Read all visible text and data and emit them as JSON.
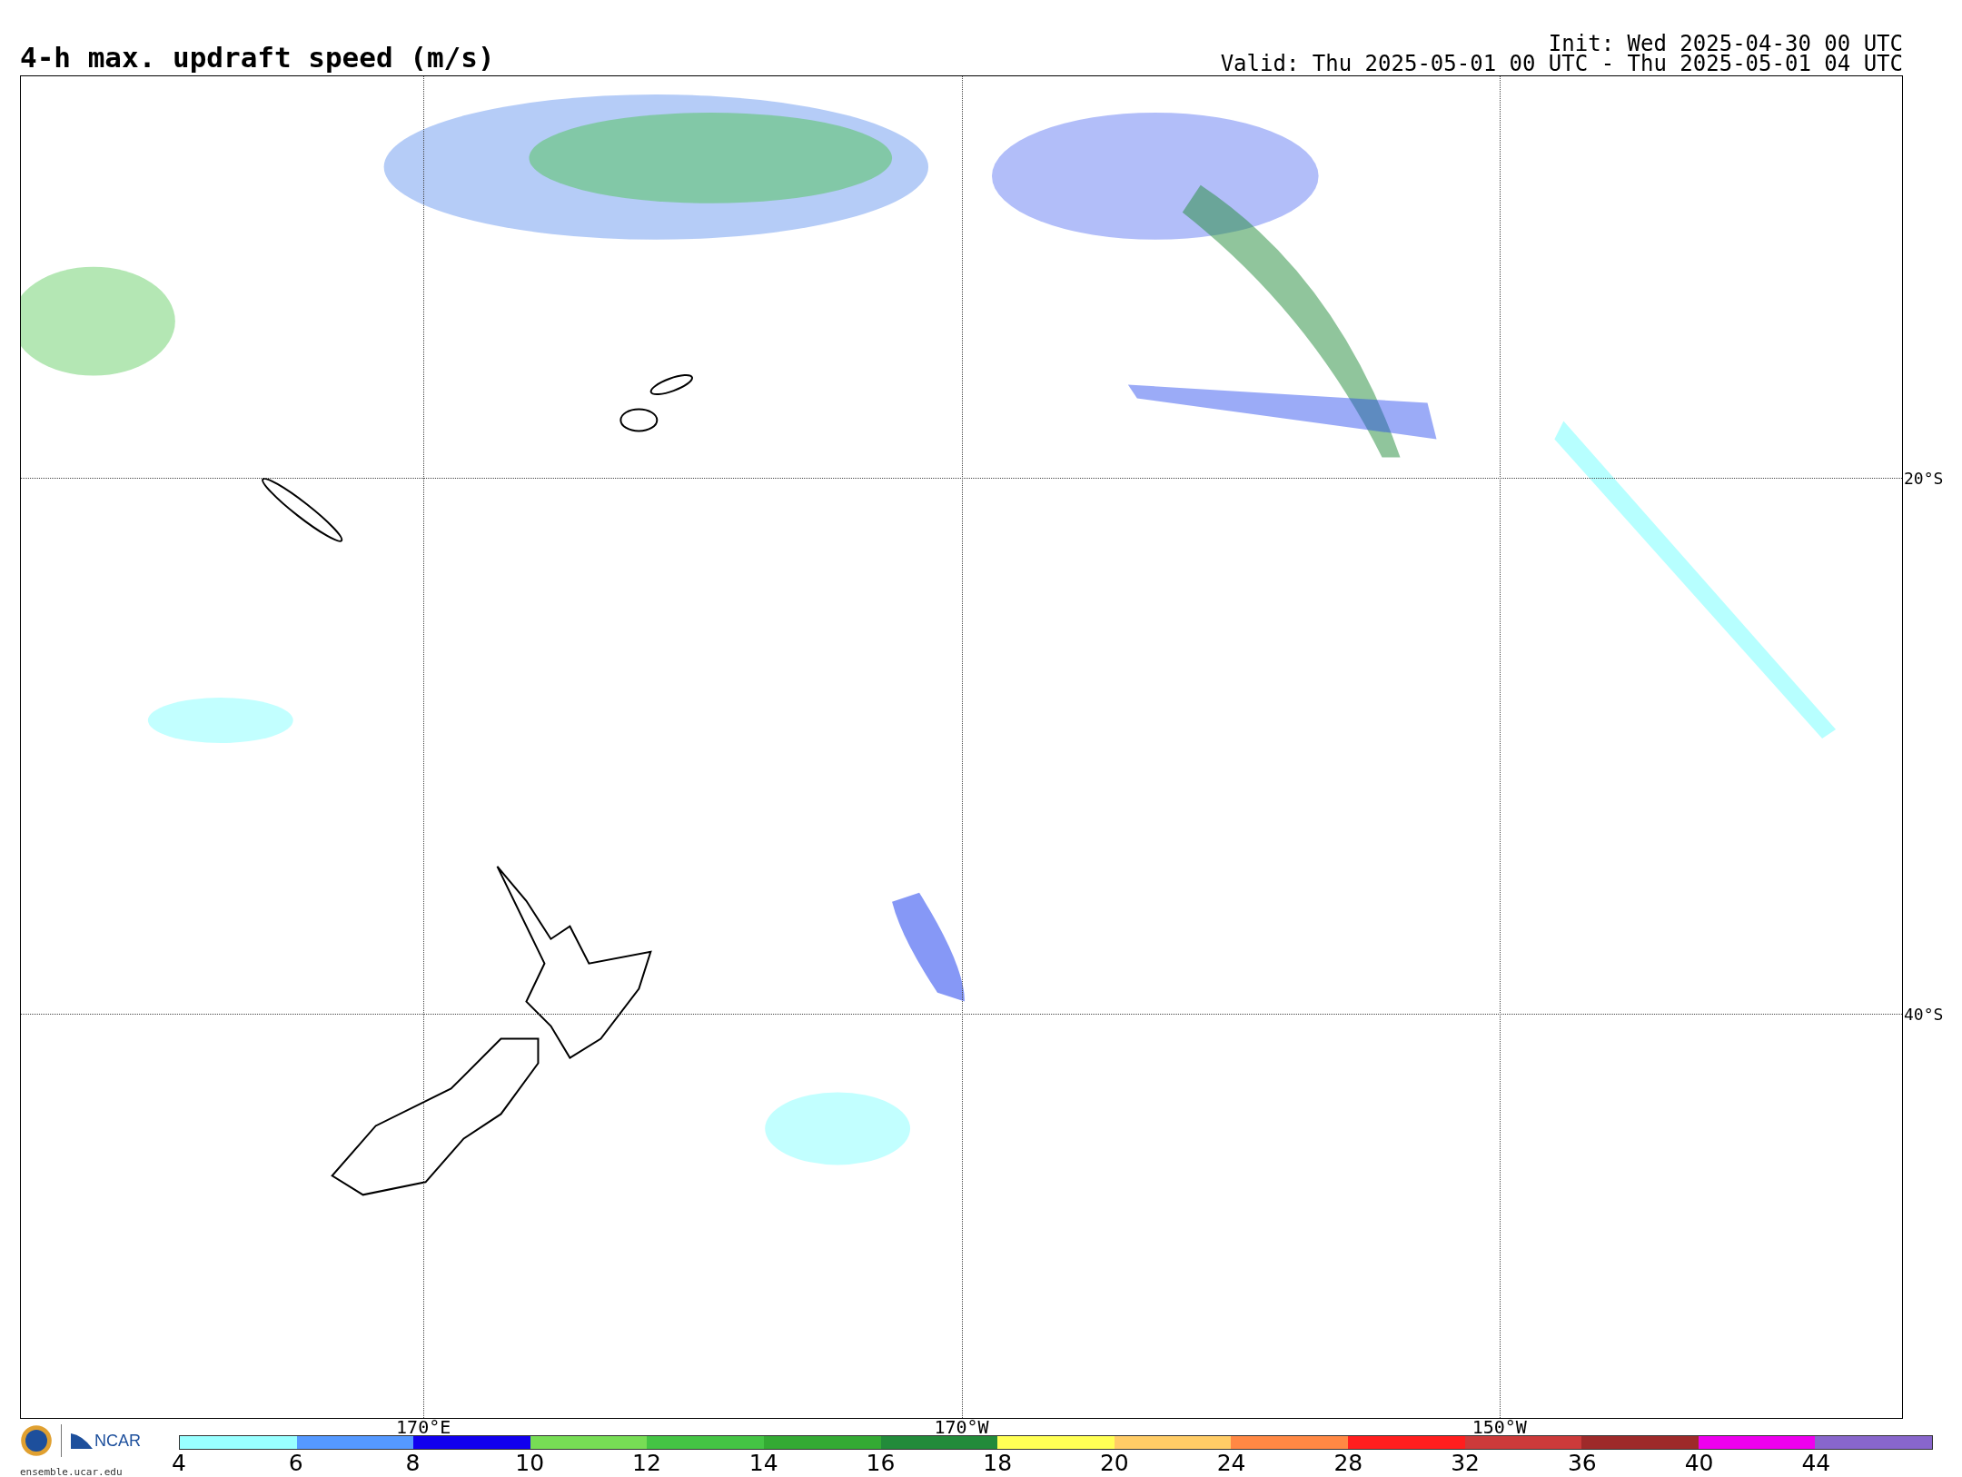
{
  "title": "4-h max. updraft speed (m/s)",
  "init": "Init: Wed 2025-04-30 00 UTC",
  "valid": "Valid: Thu 2025-05-01 00 UTC - Thu 2025-05-01 04 UTC",
  "map": {
    "lat_labels": [
      "20°S",
      "40°S"
    ],
    "lon_labels": [
      "170°E",
      "170°W",
      "150°W"
    ]
  },
  "logo": {
    "name": "NCAR",
    "url": "ensemble.ucar.edu"
  },
  "colorbar": [
    {
      "label": "4",
      "color": "#99ffff"
    },
    {
      "label": "6",
      "color": "#5599ff"
    },
    {
      "label": "8",
      "color": "#1100ee"
    },
    {
      "label": "10",
      "color": "#77dd55"
    },
    {
      "label": "12",
      "color": "#44c444"
    },
    {
      "label": "14",
      "color": "#33aa33"
    },
    {
      "label": "16",
      "color": "#228b3a"
    },
    {
      "label": "18",
      "color": "#ffff55"
    },
    {
      "label": "20",
      "color": "#ffcc66"
    },
    {
      "label": "24",
      "color": "#ff8844"
    },
    {
      "label": "28",
      "color": "#ff1e1e"
    },
    {
      "label": "32",
      "color": "#cc3a3a"
    },
    {
      "label": "36",
      "color": "#9e2a2a"
    },
    {
      "label": "40",
      "color": "#ee00ee"
    },
    {
      "label": "44",
      "color": "#8866cc"
    }
  ]
}
